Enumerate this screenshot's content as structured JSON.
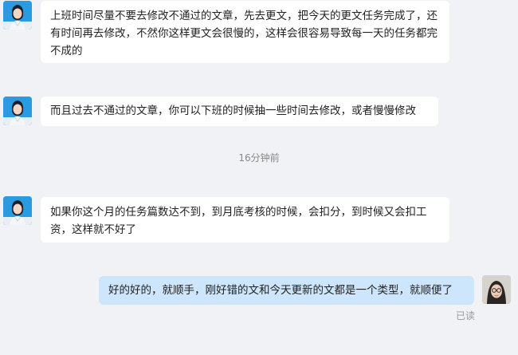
{
  "messages": [
    {
      "text": "上班时间尽量不要去修改不通过的文章，先去更文，把今天的更文任务完成了，还有时间再去修改，不然你这样更文会很慢的，这样会很容易导致每一天的任务都完不成的"
    },
    {
      "text": "而且过去不通过的文章，你可以下班的时候抽一些时间去修改，或者慢慢修改"
    },
    {
      "text": "如果你这个月的任务篇数达不到，到月底考核的时候，会扣分，到时候又会扣工资，这样就不好了"
    },
    {
      "text": "好的好的，就顺手，刚好错的文和今天更新的文都是一个类型，就顺便了"
    }
  ],
  "timestamp": "16分钟前",
  "read_status": "已读",
  "colors": {
    "background": "#f1f2f5",
    "incoming_bubble": "#ffffff",
    "outgoing_bubble": "#cde6fb",
    "avatar_bg": "#2a9be0"
  },
  "icons": {
    "contact_avatar": "person-avatar-icon",
    "self_avatar": "self-avatar-icon"
  }
}
